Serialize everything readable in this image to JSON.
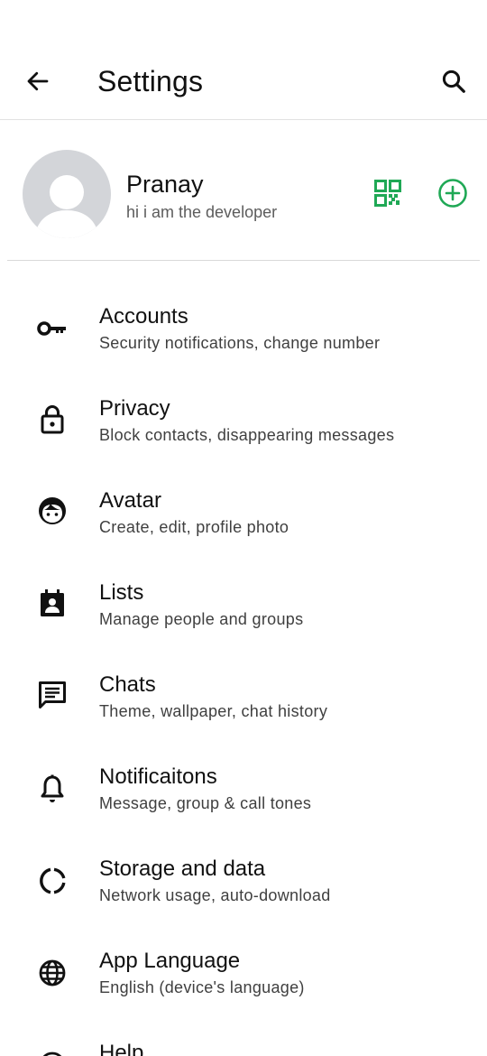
{
  "header": {
    "title": "Settings",
    "back_icon": "arrow-left-icon",
    "search_icon": "search-icon"
  },
  "profile": {
    "name": "Pranay",
    "status": "hi i am the developer",
    "qr_icon": "qr-code-icon",
    "add_icon": "add-circle-icon",
    "accent_color": "#1fa855"
  },
  "items": [
    {
      "title": "Accounts",
      "subtitle": "Security notifications, change number",
      "icon": "key-icon"
    },
    {
      "title": "Privacy",
      "subtitle": "Block contacts, disappearing messages",
      "icon": "lock-icon"
    },
    {
      "title": "Avatar",
      "subtitle": "Create, edit, profile photo",
      "icon": "avatar-face-icon"
    },
    {
      "title": "Lists",
      "subtitle": "Manage people and groups",
      "icon": "contact-list-icon"
    },
    {
      "title": "Chats",
      "subtitle": "Theme, wallpaper, chat history",
      "icon": "chat-icon"
    },
    {
      "title": "Notificaitons",
      "subtitle": "Message, group & call tones",
      "icon": "bell-icon"
    },
    {
      "title": "Storage and data",
      "subtitle": "Network usage, auto-download",
      "icon": "storage-icon"
    },
    {
      "title": "App Language",
      "subtitle": "English (device's language)",
      "icon": "globe-icon"
    },
    {
      "title": "Help",
      "subtitle": "",
      "icon": "help-icon"
    }
  ]
}
